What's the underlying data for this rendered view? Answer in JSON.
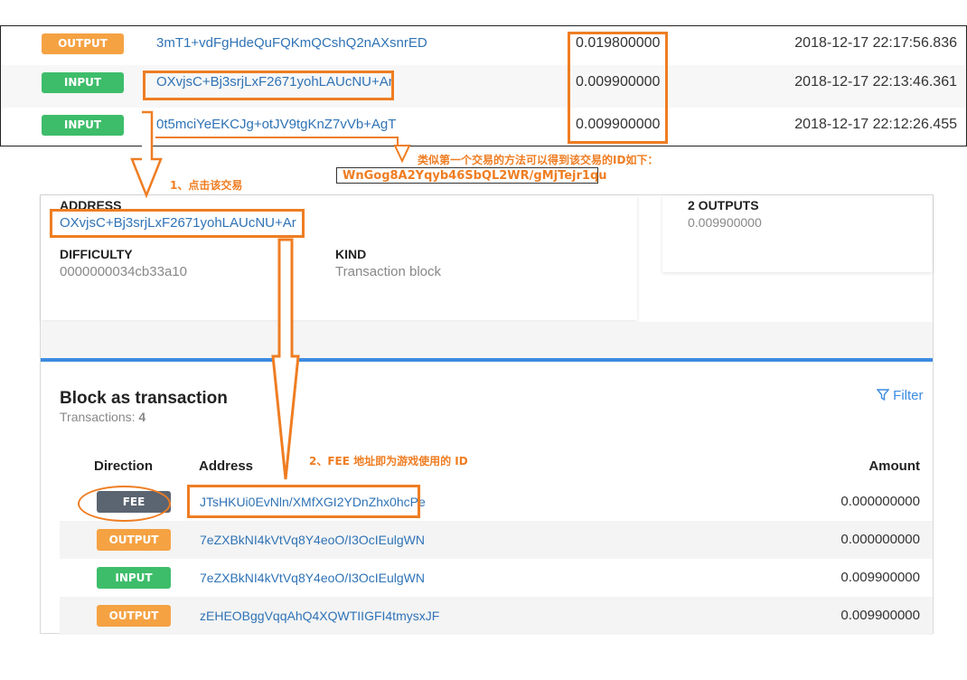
{
  "top_rows": [
    {
      "kind": "OUTPUT",
      "address": "3mT1+vdFgHdeQuFQKmQCshQ2nAXsnrED",
      "amount": "0.019800000",
      "time": "2018-12-17 22:17:56.836"
    },
    {
      "kind": "INPUT",
      "address": "OXvjsC+Bj3srjLxF2671yohLAUcNU+Ar",
      "amount": "0.009900000",
      "time": "2018-12-17 22:13:46.361"
    },
    {
      "kind": "INPUT",
      "address": "0t5mciYeEKCJg+otJV9tgKnZ7vVb+AgT",
      "amount": "0.009900000",
      "time": "2018-12-17 22:12:26.455"
    }
  ],
  "annotations": {
    "step1": "1、点击该交易",
    "similar": "类似第一个交易的方法可以得到该交易的ID如下：",
    "id_value": "WnGog8A2Yqyb46SbQL2WR/gMjTejr1qu",
    "step2": "2、FEE 地址即为游戏使用的 ID"
  },
  "detail": {
    "address_label": "ADDRESS",
    "address_value": "OXvjsC+Bj3srjLxF2671yohLAUcNU+Ar",
    "difficulty_label": "DIFFICULTY",
    "difficulty_value": "0000000034cb33a10",
    "kind_label": "KIND",
    "kind_value": "Transaction block",
    "outputs_label": "2 OUTPUTS",
    "outputs_value": "0.009900000"
  },
  "section": {
    "title": "Block as transaction",
    "transactions_label": "Transactions: ",
    "transactions_count": "4",
    "filter": "Filter",
    "col_direction": "Direction",
    "col_address": "Address",
    "col_amount": "Amount"
  },
  "tx_rows": [
    {
      "kind": "FEE",
      "address": "JTsHKUi0EvNln/XMfXGI2YDnZhx0hcPe",
      "amount": "0.000000000"
    },
    {
      "kind": "OUTPUT",
      "address": "7eZXBkNI4kVtVq8Y4eoO/I3OcIEulgWN",
      "amount": "0.000000000"
    },
    {
      "kind": "INPUT",
      "address": "7eZXBkNI4kVtVq8Y4eoO/I3OcIEulgWN",
      "amount": "0.009900000"
    },
    {
      "kind": "OUTPUT",
      "address": "zEHEOBggVqqAhQ4XQWTIIGFI4tmysxJF",
      "amount": "0.009900000"
    }
  ],
  "colors": {
    "accent": "#ef7d22",
    "output": "#f5a243",
    "input": "#3dbd6a",
    "fee": "#5b6471",
    "link": "#2f73b6"
  }
}
